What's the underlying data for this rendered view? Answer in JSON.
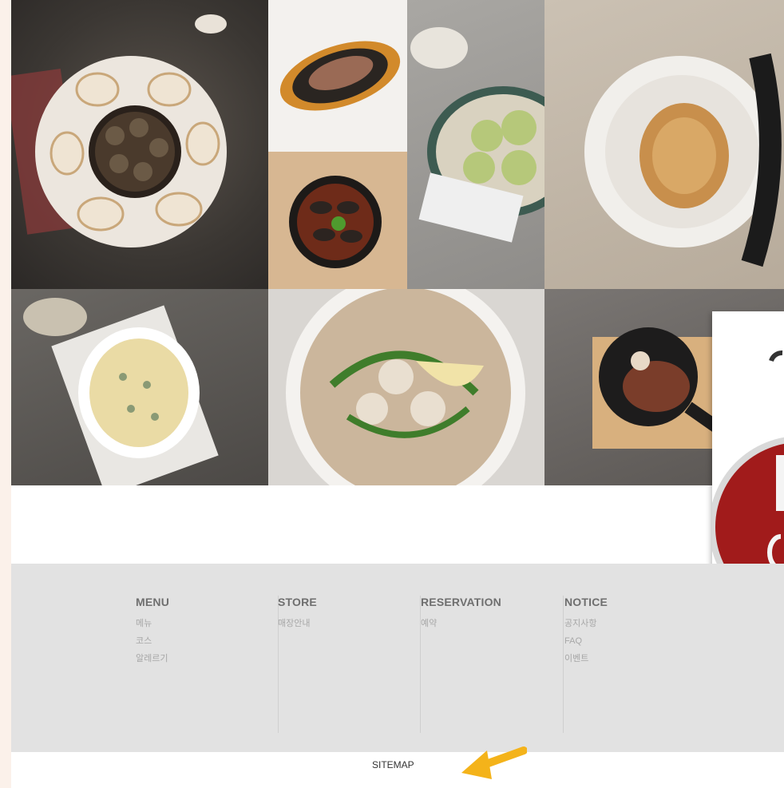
{
  "tiles": [
    {
      "name": "escargot-dish-photo"
    },
    {
      "name": "steak-plate-photo"
    },
    {
      "name": "mussel-pan-photo"
    },
    {
      "name": "salad-photo"
    },
    {
      "name": "pasta-photo"
    },
    {
      "name": "gratin-photo"
    },
    {
      "name": "risotto-photo"
    },
    {
      "name": "steak-skillet-photo"
    }
  ],
  "footer": {
    "columns": [
      {
        "title": "MENU",
        "links": [
          "메뉴",
          "코스",
          "알레르기"
        ]
      },
      {
        "title": "STORE",
        "links": [
          "매장안내"
        ]
      },
      {
        "title": "RESERVATION",
        "links": [
          "예약"
        ]
      },
      {
        "title": "NOTICE",
        "links": [
          "공지사항",
          "FAQ",
          "이벤트"
        ]
      }
    ]
  },
  "sitemap": {
    "label": "SITEMAP"
  },
  "colors": {
    "accent_arrow": "#f4b31a",
    "badge_red": "#a11b1b",
    "footer_bg": "#e2e2e2"
  }
}
